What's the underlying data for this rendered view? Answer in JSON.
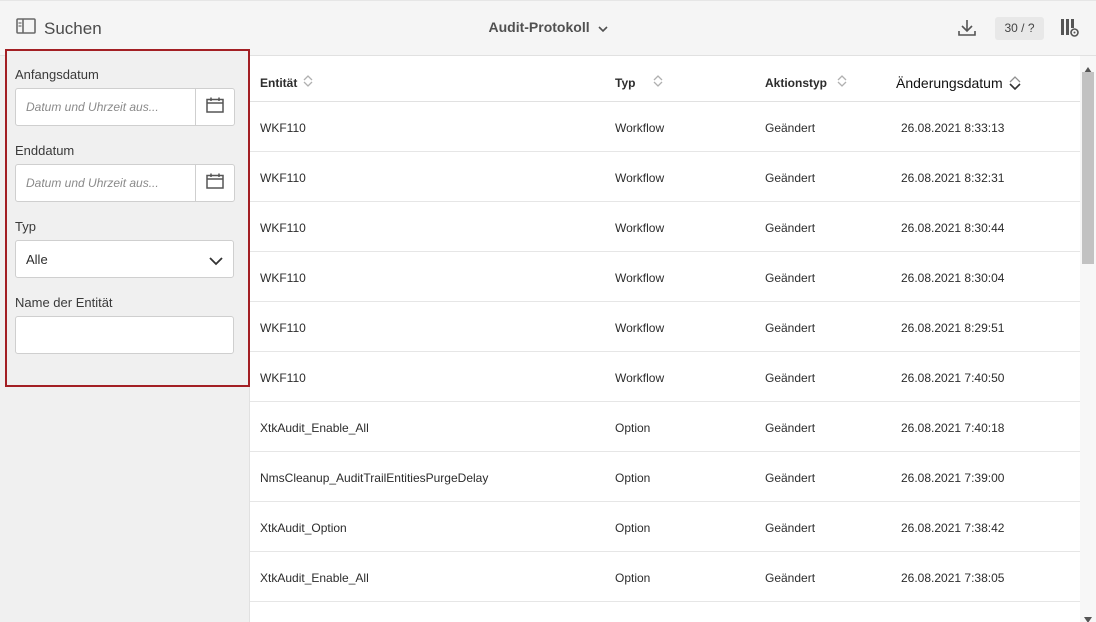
{
  "header": {
    "search_label": "Suchen",
    "title": "Audit-Protokoll",
    "count": "30 / ?"
  },
  "filters": {
    "start_label": "Anfangsdatum",
    "start_placeholder": "Datum und Uhrzeit aus...",
    "end_label": "Enddatum",
    "end_placeholder": "Datum und Uhrzeit aus...",
    "type_label": "Typ",
    "type_value": "Alle",
    "entity_label": "Name der Entität",
    "entity_value": ""
  },
  "table": {
    "columns": [
      "Entität",
      "Typ",
      "Aktionstyp",
      "Änderungsdatum"
    ],
    "rows": [
      {
        "entity": "WKF110",
        "type": "Workflow",
        "action": "Geändert",
        "date": "26.08.2021 8:33:13"
      },
      {
        "entity": "WKF110",
        "type": "Workflow",
        "action": "Geändert",
        "date": "26.08.2021 8:32:31"
      },
      {
        "entity": "WKF110",
        "type": "Workflow",
        "action": "Geändert",
        "date": "26.08.2021 8:30:44"
      },
      {
        "entity": "WKF110",
        "type": "Workflow",
        "action": "Geändert",
        "date": "26.08.2021 8:30:04"
      },
      {
        "entity": "WKF110",
        "type": "Workflow",
        "action": "Geändert",
        "date": "26.08.2021 8:29:51"
      },
      {
        "entity": "WKF110",
        "type": "Workflow",
        "action": "Geändert",
        "date": "26.08.2021 7:40:50"
      },
      {
        "entity": "XtkAudit_Enable_All",
        "type": "Option",
        "action": "Geändert",
        "date": "26.08.2021 7:40:18"
      },
      {
        "entity": "NmsCleanup_AuditTrailEntitiesPurgeDelay",
        "type": "Option",
        "action": "Geändert",
        "date": "26.08.2021 7:39:00"
      },
      {
        "entity": "XtkAudit_Option",
        "type": "Option",
        "action": "Geändert",
        "date": "26.08.2021 7:38:42"
      },
      {
        "entity": "XtkAudit_Enable_All",
        "type": "Option",
        "action": "Geändert",
        "date": "26.08.2021 7:38:05"
      }
    ]
  },
  "icons": {
    "search_panel": "panel-toggle-icon",
    "download": "download-icon",
    "columns": "column-settings-icon",
    "calendar": "calendar-icon",
    "sort": "sort-icon",
    "chevron": "chevron-down-icon"
  },
  "colors": {
    "highlight_border": "#a31f24",
    "panel_bg": "#f0f0f0",
    "header_bg": "#f5f5f5"
  }
}
